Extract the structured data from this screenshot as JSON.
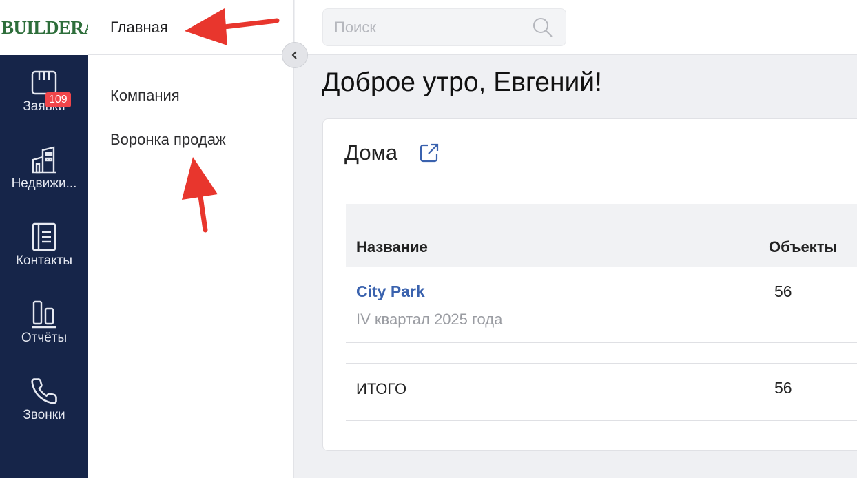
{
  "app": {
    "logo_text": "BUILDERA",
    "brand_color": "#2e6e3b",
    "rail_color": "#162549"
  },
  "rail": {
    "items": [
      {
        "label": "Заявки",
        "icon": "requests-icon",
        "badge": "109"
      },
      {
        "label": "Недвижи...",
        "icon": "building-icon"
      },
      {
        "label": "Контакты",
        "icon": "contacts-icon"
      },
      {
        "label": "Отчёты",
        "icon": "reports-icon"
      },
      {
        "label": "Звонки",
        "icon": "phone-icon"
      }
    ]
  },
  "submenu": {
    "header": "Главная",
    "items": [
      {
        "label": "Компания"
      },
      {
        "label": "Воронка продаж"
      }
    ]
  },
  "search": {
    "placeholder": "Поиск"
  },
  "main": {
    "greeting": "Доброе утро, Евгений!",
    "card": {
      "title": "Дома",
      "columns": [
        "Название",
        "Объекты"
      ],
      "rows": [
        {
          "name": "City Park",
          "subtitle": "IV квартал 2025 года",
          "objects": "56"
        }
      ],
      "total": {
        "label": "ИТОГО",
        "objects": "56"
      }
    }
  },
  "annotations": {
    "arrow_color": "#e8362d"
  }
}
